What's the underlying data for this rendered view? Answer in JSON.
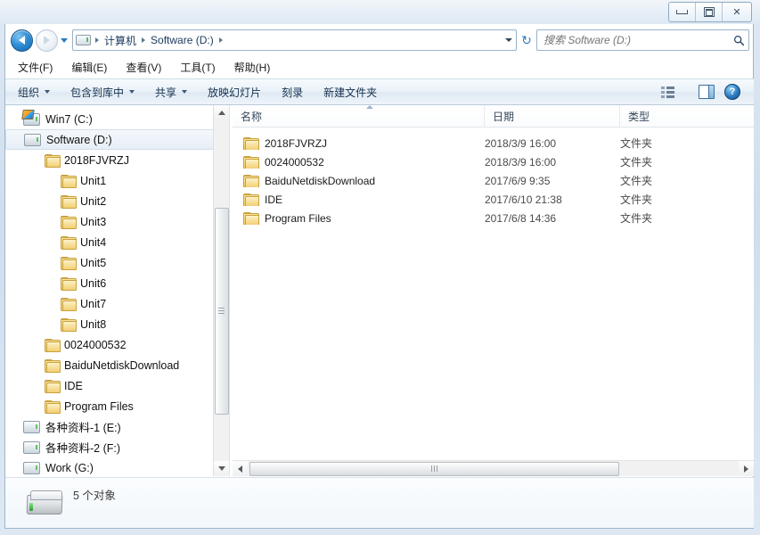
{
  "window": {
    "minimize_label": "最小化",
    "maximize_label": "最大化",
    "close_label": "✕"
  },
  "nav": {
    "back_label": "后退",
    "forward_label": "前进",
    "history_label": "最近浏览的位置",
    "refresh_label": "↻",
    "dropdown_label": "▾"
  },
  "breadcrumb": {
    "items": [
      {
        "label": "计算机"
      },
      {
        "label": "Software (D:)"
      }
    ]
  },
  "search": {
    "placeholder": "搜索 Software (D:)",
    "value": "",
    "icon_label": "⌕"
  },
  "menubar": {
    "items": [
      {
        "label": "文件(F)"
      },
      {
        "label": "编辑(E)"
      },
      {
        "label": "查看(V)"
      },
      {
        "label": "工具(T)"
      },
      {
        "label": "帮助(H)"
      }
    ]
  },
  "toolbar": {
    "buttons": [
      {
        "label": "组织",
        "has_caret": true
      },
      {
        "label": "包含到库中",
        "has_caret": true
      },
      {
        "label": "共享",
        "has_caret": true
      },
      {
        "label": "放映幻灯片",
        "has_caret": false
      },
      {
        "label": "刻录",
        "has_caret": false
      },
      {
        "label": "新建文件夹",
        "has_caret": false
      }
    ],
    "views_label": "更改视图",
    "preview_label": "显示预览窗格",
    "help_label": "?"
  },
  "sidebar": {
    "items": [
      {
        "label": "Win7 (C:)",
        "icon": "drive-os-icon",
        "indent": 20,
        "selected": false
      },
      {
        "label": "Software (D:)",
        "icon": "drive-icon",
        "indent": 20,
        "selected": true
      },
      {
        "label": "2018FJVRZJ",
        "icon": "folder-icon",
        "indent": 44,
        "selected": false
      },
      {
        "label": "Unit1",
        "icon": "folder-icon",
        "indent": 62,
        "selected": false
      },
      {
        "label": "Unit2",
        "icon": "folder-icon",
        "indent": 62,
        "selected": false
      },
      {
        "label": "Unit3",
        "icon": "folder-icon",
        "indent": 62,
        "selected": false
      },
      {
        "label": "Unit4",
        "icon": "folder-icon",
        "indent": 62,
        "selected": false
      },
      {
        "label": "Unit5",
        "icon": "folder-icon",
        "indent": 62,
        "selected": false
      },
      {
        "label": "Unit6",
        "icon": "folder-icon",
        "indent": 62,
        "selected": false
      },
      {
        "label": "Unit7",
        "icon": "folder-icon",
        "indent": 62,
        "selected": false
      },
      {
        "label": "Unit8",
        "icon": "folder-icon",
        "indent": 62,
        "selected": false
      },
      {
        "label": "0024000532",
        "icon": "folder-icon",
        "indent": 44,
        "selected": false
      },
      {
        "label": "BaiduNetdiskDownload",
        "icon": "folder-icon",
        "indent": 44,
        "selected": false
      },
      {
        "label": "IDE",
        "icon": "folder-icon",
        "indent": 44,
        "selected": false
      },
      {
        "label": "Program Files",
        "icon": "folder-icon",
        "indent": 44,
        "selected": false
      },
      {
        "label": "各种资料-1 (E:)",
        "icon": "drive-icon",
        "indent": 20,
        "selected": false
      },
      {
        "label": "各种资料-2 (F:)",
        "icon": "drive-icon",
        "indent": 20,
        "selected": false
      },
      {
        "label": "Work (G:)",
        "icon": "drive-icon",
        "indent": 20,
        "selected": false
      }
    ]
  },
  "filelist": {
    "columns": [
      {
        "label": "名称"
      },
      {
        "label": "日期"
      },
      {
        "label": "类型"
      }
    ],
    "sort_column": "名称",
    "sort_direction": "asc",
    "rows": [
      {
        "name": "2018FJVRZJ",
        "date": "2018/3/9 16:00",
        "type": "文件夹"
      },
      {
        "name": "0024000532",
        "date": "2018/3/9 16:00",
        "type": "文件夹"
      },
      {
        "name": "BaiduNetdiskDownload",
        "date": "2017/6/9 9:35",
        "type": "文件夹"
      },
      {
        "name": "IDE",
        "date": "2017/6/10 21:38",
        "type": "文件夹"
      },
      {
        "name": "Program Files",
        "date": "2017/6/8 14:36",
        "type": "文件夹"
      }
    ]
  },
  "statusbar": {
    "text": "5 个对象"
  },
  "colors": {
    "accent": "#2b7cc0",
    "frame": "#9fb6cd",
    "folder": "#f3cf72",
    "selection": "#e6eef6"
  }
}
